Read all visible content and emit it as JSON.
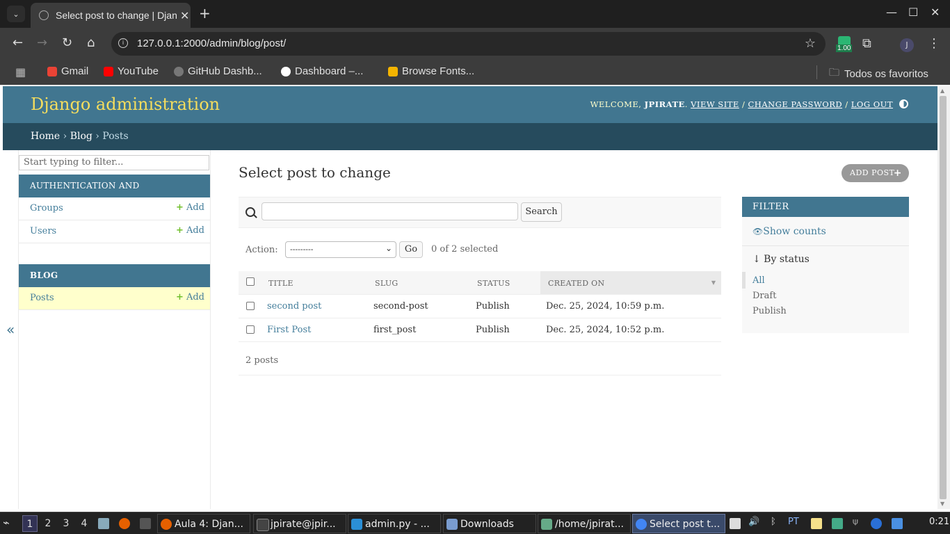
{
  "browser": {
    "tab_title": "Select post to change | Django site admin",
    "url": "127.0.0.1:2000/admin/blog/post/",
    "extension_badge": "1.00",
    "profile_initial": "J",
    "bookmarks": [
      "Gmail",
      "YouTube",
      "GitHub Dashb...",
      "Dashboard –...",
      "Browse Fonts..."
    ],
    "all_bookmarks": "Todos os favoritos"
  },
  "header": {
    "branding": "Django administration",
    "welcome": "WELCOME,",
    "username": "JPIRATE",
    "view_site": "VIEW SITE",
    "change_password": "CHANGE PASSWORD",
    "log_out": "LOG OUT"
  },
  "breadcrumbs": {
    "home": "Home",
    "app": "Blog",
    "current": "Posts"
  },
  "sidebar": {
    "filter_placeholder": "Start typing to filter...",
    "modules": [
      {
        "caption": "AUTHENTICATION AND AUTHORIZATION",
        "items": [
          {
            "label": "Groups",
            "add": "Add"
          },
          {
            "label": "Users",
            "add": "Add"
          }
        ]
      },
      {
        "caption": "BLOG",
        "items": [
          {
            "label": "Posts",
            "add": "Add"
          }
        ]
      }
    ],
    "collapse": "«"
  },
  "main": {
    "title": "Select post to change",
    "add_button": "ADD POST",
    "search_button": "Search",
    "action_label": "Action:",
    "action_select": "---------",
    "go_button": "Go",
    "selection_counter": "0 of 2 selected",
    "columns": [
      "TITLE",
      "SLUG",
      "STATUS",
      "CREATED ON"
    ],
    "rows": [
      {
        "title": "second post",
        "slug": "second-post",
        "status": "Publish",
        "created_on": "Dec. 25, 2024, 10:59 p.m."
      },
      {
        "title": "First Post",
        "slug": "first_post",
        "status": "Publish",
        "created_on": "Dec. 25, 2024, 10:52 p.m."
      }
    ],
    "paginator": "2 posts"
  },
  "filter": {
    "caption": "FILTER",
    "show_counts": "Show counts",
    "by_status": "↓ By status",
    "options": [
      "All",
      "Draft",
      "Publish"
    ]
  },
  "taskbar": {
    "workspaces": [
      "1",
      "2",
      "3",
      "4"
    ],
    "apps": [
      "Aula 4: Djan...",
      "jpirate@jpir...",
      "admin.py - ...",
      "Downloads",
      "/home/jpirat...",
      "Select post t..."
    ],
    "lang": "PT",
    "clock": "0:21"
  }
}
